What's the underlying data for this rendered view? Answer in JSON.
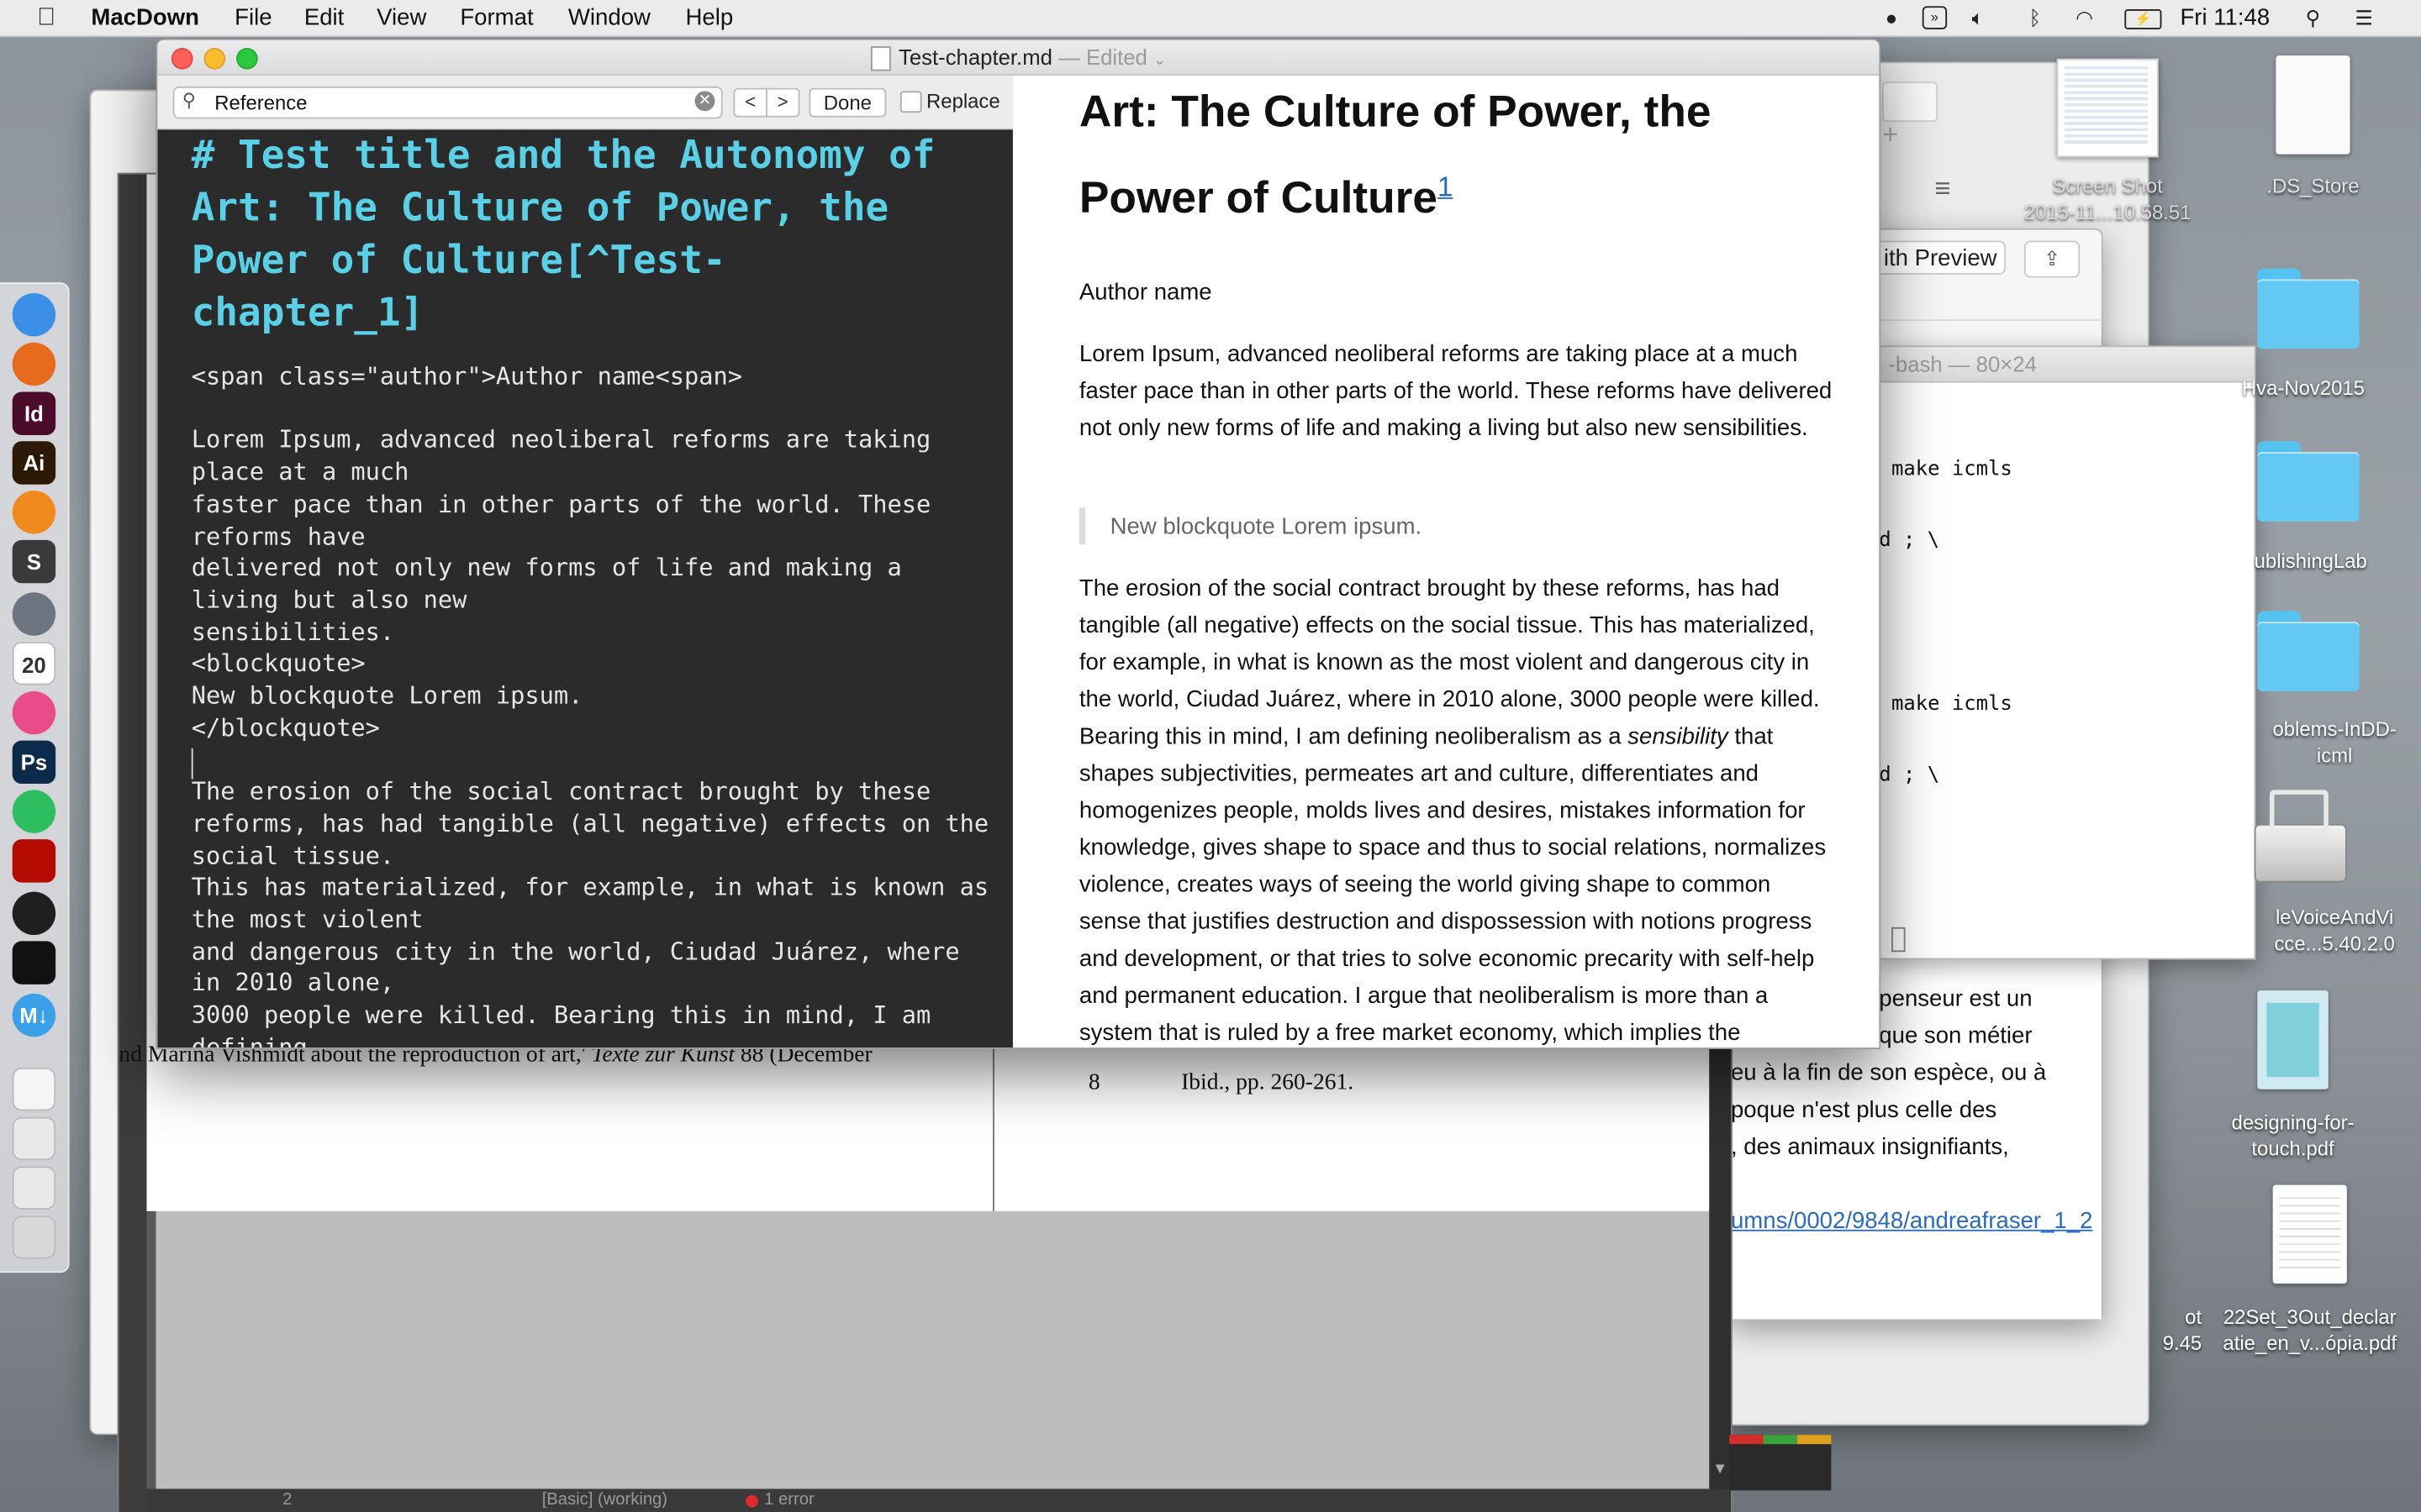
{
  "menubar": {
    "app_name": "MacDown",
    "menus": [
      "File",
      "Edit",
      "View",
      "Format",
      "Window",
      "Help"
    ],
    "clock": "Fri 11:48",
    "status_icons": [
      "evernote-icon",
      "dashboard-icon",
      "volume-icon",
      "bluetooth-icon",
      "wifi-icon",
      "battery-icon",
      "spotlight-icon",
      "notification-center-icon"
    ]
  },
  "window": {
    "title": "Test-chapter.md",
    "edited_label": "— Edited"
  },
  "findbar": {
    "search_value": "Reference",
    "done_label": "Done",
    "replace_label": "Replace"
  },
  "editor": {
    "heading": "# Test title and the Autonomy of\nArt: The Culture of Power, the\nPower of Culture[^Test-\nchapter_1]",
    "body": "<span class=\"author\">Author name<span>\n\nLorem Ipsum, advanced neoliberal reforms are taking\nplace at a much\nfaster pace than in other parts of the world. These\nreforms have\ndelivered not only new forms of life and making a\nliving but also new\nsensibilities.\n<blockquote>\nNew blockquote Lorem ipsum.\n</blockquote>\n\nThe erosion of the social contract brought by these\nreforms, has had tangible (all negative) effects on the\nsocial tissue.\nThis has materialized, for example, in what is known as\nthe most violent\nand dangerous city in the world, Ciudad Juárez, where\nin 2010 alone,\n3000 people were killed. Bearing this in mind, I am\ndefining"
  },
  "preview": {
    "title_line1": "Art: The Culture of Power, the",
    "title_line2": "Power of Culture",
    "footnote_ref": "1",
    "author": "Author name",
    "para1": "Lorem Ipsum, advanced neoliberal reforms are taking place at a much faster pace than in other parts of the world. These reforms have delivered not only new forms of life and making a living but also new sensibilities.",
    "blockquote": "New blockquote Lorem ipsum.",
    "para2_before": "The erosion of the social contract brought by these reforms, has had tangible (all negative) effects on the social tissue. This has materialized, for example, in what is known as the most violent and dangerous city in the world, Ciudad Juárez, where in 2010 alone, 3000 people were killed. Bearing this in mind, I am defining neoliberalism as a ",
    "para2_em": "sensibility",
    "para2_after": " that shapes subjectivities, permeates art and culture, differentiates and homogenizes people, molds lives and desires, mistakes information for knowledge, gives shape to space and thus to social relations, normalizes violence, creates ways of seeing the world giving shape to common sense that justifies destruction and dispossession with notions progress and development, or that tries to solve economic precarity with self-help and permanent education. I argue that neoliberalism is more than a system that is ruled by a free market economy, which implies the privatization of the welfare state"
  },
  "indesign": {
    "footnote_left": "nd Marina Vishmidt about the reproduction of art,' ",
    "footnote_left_italic": "Texte zur Kunst",
    "footnote_left_end": " 88 (December",
    "footnote_num": "8",
    "footnote_right": "Ibid., pp. 260-261.",
    "status_page": "2",
    "status_basic": "[Basic] (working)",
    "status_error": "1 error"
  },
  "terminal": {
    "title": "-bash — 80×24",
    "lines": [
      "make icmls",
      "d ; \\",
      "make icmls",
      "d ; \\"
    ]
  },
  "french_doc": {
    "lines": [
      "penseur est un",
      "que son métier",
      "eu à la fin de son espèce, ou à",
      "poque n'est plus celle des",
      ", des animaux insignifiants,"
    ],
    "link": "umns/0002/9848/andreafraser_1_2"
  },
  "preview_window": {
    "share_label": "ith Preview"
  },
  "desktop": {
    "icons": [
      {
        "label": "Screen Shot\n2015-11...10.58.51"
      },
      {
        "label": ".DS_Store"
      },
      {
        "label": "Hva-Nov2015"
      },
      {
        "label": "ublishingLab"
      },
      {
        "label": "oblems-InDD-\nicml"
      },
      {
        "label": "leVoiceAndVi\ncce...5.40.2.0"
      },
      {
        "label": "designing-for-\ntouch.pdf"
      },
      {
        "label": "22Set_3Out_declar\natie_en_v...ópia.pdf"
      },
      {
        "label": "ot\n9.45"
      }
    ]
  },
  "dock": {
    "apps": [
      {
        "name": "finder-icon",
        "label": "",
        "color": "#3c8fe6"
      },
      {
        "name": "firefox-icon",
        "label": "",
        "color": "#e66b1c"
      },
      {
        "name": "indesign-icon",
        "label": "Id",
        "color": "#4a0c2a"
      },
      {
        "name": "illustrator-icon",
        "label": "Ai",
        "color": "#2d1a06"
      },
      {
        "name": "ibooks-icon",
        "label": "",
        "color": "#f08a1e"
      },
      {
        "name": "sublime-icon",
        "label": "S",
        "color": "#3a3a3a"
      },
      {
        "name": "launchpad-icon",
        "label": "",
        "color": "#6c7580"
      },
      {
        "name": "calendar-icon",
        "label": "20",
        "color": "#ffffff"
      },
      {
        "name": "itunes-icon",
        "label": "",
        "color": "#e84c8b"
      },
      {
        "name": "photoshop-icon",
        "label": "Ps",
        "color": "#0c2a4a"
      },
      {
        "name": "evernote-icon",
        "label": "",
        "color": "#2dbe60"
      },
      {
        "name": "acrobat-icon",
        "label": "",
        "color": "#b30b00"
      },
      {
        "name": "github-icon",
        "label": "",
        "color": "#1f1f1f"
      },
      {
        "name": "terminal-icon",
        "label": "",
        "color": "#111111"
      },
      {
        "name": "macdown-icon",
        "label": "M↓",
        "color": "#3aa0e8"
      },
      {
        "name": "document-icon",
        "label": "",
        "color": "#f5f5f5"
      },
      {
        "name": "preview-icon",
        "label": "",
        "color": "#e9e9e9"
      },
      {
        "name": "screenshot-icon",
        "label": "",
        "color": "#e9e9e9"
      },
      {
        "name": "trash-icon",
        "label": "",
        "color": "#d8d8d8"
      }
    ]
  }
}
